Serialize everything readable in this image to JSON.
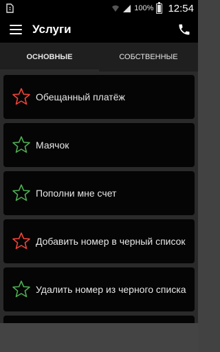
{
  "status_bar": {
    "battery": "100%",
    "time": "12:54"
  },
  "app_bar": {
    "title": "Услуги"
  },
  "tabs": [
    {
      "label": "ОСНОВНЫЕ",
      "active": true
    },
    {
      "label": "СОБСТВЕННЫЕ",
      "active": false
    }
  ],
  "services": [
    {
      "label": "Обещанный платёж",
      "star_color": "#f44336"
    },
    {
      "label": "Маячок",
      "star_color": "#4caf50"
    },
    {
      "label": "Пополни мне счет",
      "star_color": "#4caf50"
    },
    {
      "label": "Добавить номер в черный список",
      "star_color": "#f44336"
    },
    {
      "label": "Удалить номер из черного списка",
      "star_color": "#4caf50"
    }
  ]
}
